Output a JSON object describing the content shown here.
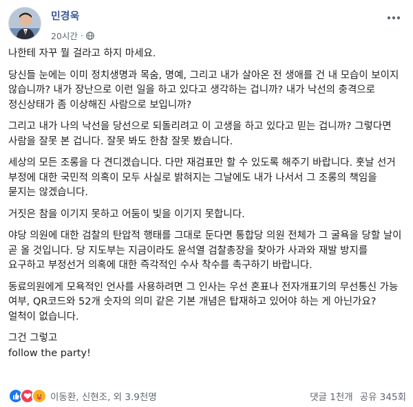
{
  "post": {
    "author": "민경욱",
    "time": "20시간",
    "visibility_icon": "globe-icon",
    "more_icon": "ellipsis-icon",
    "paragraphs": [
      "나한테 자꾸 뭘 걸라고 하지 마세요.",
      "당신들 눈에는 이미 정치생명과 목숨, 명예, 그리고 내가 살아온 전 생애를 건 내 모습이 보이지 않습니까? 내가 장난으로 이런 일을 하고 있다고 생각하는 겁니까? 내가 낙선의 충격으로 정신상태가 좀 이상해진 사람으로 보입니까?",
      "그리고 내가 나의 낙선을 당선으로 되돌리려고 이 고생을 하고 있다고 믿는 겁니까? 그렇다면 사람을 잘못 본 겁니다. 잘못 봐도 한참 잘못 봤습니다.",
      "세상의 모든 조롱을 다 견디겠습니다. 다만 재검표만 할 수 있도록 해주기 바랍니다. 훗날 선거 부정에 대한 국민적 의혹이 모두 사실로 밝혀지는 그날에도 내가 나서서 그 조롱의 책임을 묻지는 않겠습니다.",
      "거짓은 참을 이기지 못하고 어둠이 빛을 이기지 못합니다.",
      "야당 의원에 대한 검찰의 탄압적 행태를 그대로 둔다면 통합당 의원 전체가 그 굴욕을 당할 날이 곧 올 것입니다. 당 지도부는 지금이라도 윤석열 검찰총장을 찾아가 사과와 재발 방지를 요구하고 부정선거 의혹에 대한 즉각적인 수사 착수를 촉구하기 바랍니다.",
      "동료의원에게 모욕적인 언사를 사용하려면 그 인사는 우선 혼표나 전자개표기의 무선통신 가능 여부, QR코드와 52개 숫자의 의미 같은 기본 개념은 탑재하고 있어야 하는 게 아닌가요? 얼척이 없습니다.",
      "그건 그렇고\nfollow the party!"
    ]
  },
  "footer": {
    "reactions": [
      "like-icon",
      "love-icon",
      "care-icon"
    ],
    "names": "이동환, 신현조, 외 3.9천명",
    "comments": "댓글 1천개",
    "shares": "공유 345회"
  },
  "colors": {
    "author": "#385898",
    "muted": "#606770",
    "like": "#1877f2",
    "love": "#f33e58",
    "care": "#f7b125"
  }
}
